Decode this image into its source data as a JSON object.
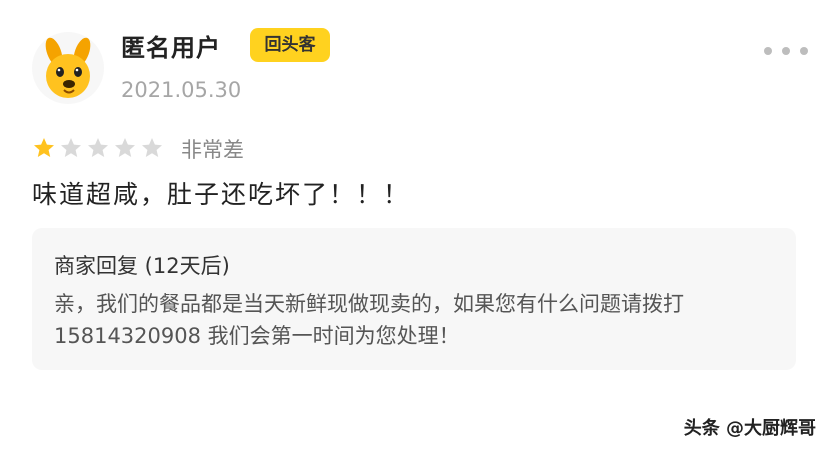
{
  "review": {
    "user": {
      "name": "匿名用户",
      "badge": "回头客",
      "date": "2021.05.30",
      "avatar": "dog-mascot-avatar"
    },
    "rating": {
      "stars_filled": 1,
      "stars_total": 5,
      "label": "非常差"
    },
    "text": "味道超咸，肚子还吃坏了！！！",
    "merchant_reply": {
      "title": "商家回复 (12天后)",
      "text": "亲，我们的餐品都是当天新鲜现做现卖的，如果您有什么问题请拨打 15814320908 我们会第一时间为您处理！"
    }
  },
  "watermark": "头条 @大厨辉哥",
  "colors": {
    "badge": "#ffd21f",
    "star_filled": "#ffc21f",
    "star_empty": "#d9d9d9",
    "reply_bg": "#f7f7f7"
  }
}
